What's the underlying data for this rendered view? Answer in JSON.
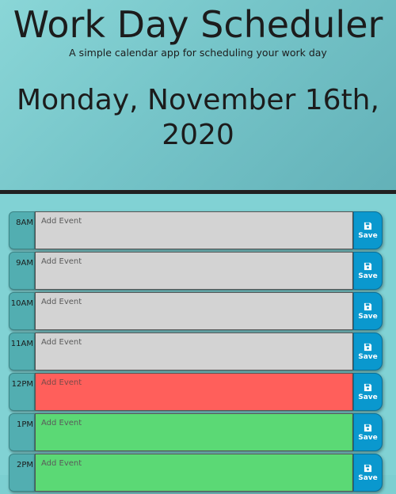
{
  "header": {
    "title": "Work Day Scheduler",
    "subtitle": "A simple calendar app for scheduling your work day",
    "current_day": "Monday, November 16th, 2020"
  },
  "colors": {
    "past": "#d3d3d3",
    "present": "#ff5f5b",
    "future": "#5bd975",
    "save_button": "#0a98ce",
    "hour_column": "#52aeb1",
    "background": "#81d2d4"
  },
  "timeblocks": [
    {
      "hour": "8AM",
      "placeholder": "Add Event",
      "value": "",
      "status": "past",
      "save_label": "Save",
      "save_icon": "floppy-disk-icon"
    },
    {
      "hour": "9AM",
      "placeholder": "Add Event",
      "value": "",
      "status": "past",
      "save_label": "Save",
      "save_icon": "floppy-disk-icon"
    },
    {
      "hour": "10AM",
      "placeholder": "Add Event",
      "value": "",
      "status": "past",
      "save_label": "Save",
      "save_icon": "floppy-disk-icon"
    },
    {
      "hour": "11AM",
      "placeholder": "Add Event",
      "value": "",
      "status": "past",
      "save_label": "Save",
      "save_icon": "floppy-disk-icon"
    },
    {
      "hour": "12PM",
      "placeholder": "Add Event",
      "value": "",
      "status": "present",
      "save_label": "Save",
      "save_icon": "floppy-disk-icon"
    },
    {
      "hour": "1PM",
      "placeholder": "Add Event",
      "value": "",
      "status": "future",
      "save_label": "Save",
      "save_icon": "floppy-disk-icon"
    },
    {
      "hour": "2PM",
      "placeholder": "Add Event",
      "value": "",
      "status": "future",
      "save_label": "Save",
      "save_icon": "floppy-disk-icon"
    }
  ]
}
